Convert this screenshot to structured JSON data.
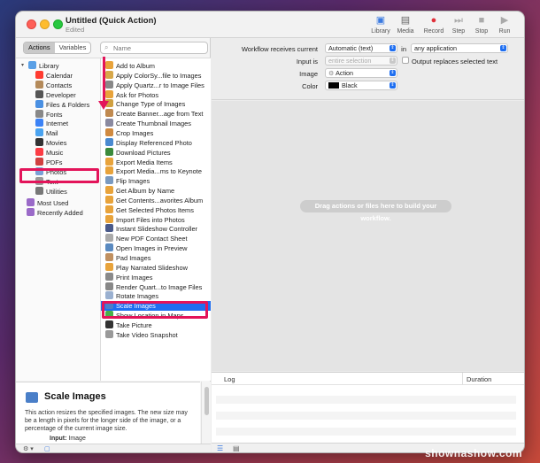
{
  "window": {
    "title": "Untitled (Quick Action)",
    "subtitle": "Edited"
  },
  "toolbar": {
    "library": "Library",
    "media": "Media",
    "record": "Record",
    "step": "Step",
    "stop": "Stop",
    "run": "Run"
  },
  "library_panel": {
    "tab_actions": "Actions",
    "tab_variables": "Variables",
    "search_placeholder": "Name",
    "categories": [
      {
        "label": "Library",
        "color": "#5aa0e6"
      },
      {
        "label": "Calendar",
        "color": "#ff3b30"
      },
      {
        "label": "Contacts",
        "color": "#b48a5a"
      },
      {
        "label": "Developer",
        "color": "#555555"
      },
      {
        "label": "Files & Folders",
        "color": "#4a90e2"
      },
      {
        "label": "Fonts",
        "color": "#888888"
      },
      {
        "label": "Internet",
        "color": "#3b82f6"
      },
      {
        "label": "Mail",
        "color": "#4aa3f0"
      },
      {
        "label": "Movies",
        "color": "#333333"
      },
      {
        "label": "Music",
        "color": "#fc3c44"
      },
      {
        "label": "PDFs",
        "color": "#d04040"
      },
      {
        "label": "Photos",
        "color": "#7aa0d6"
      },
      {
        "label": "Text",
        "color": "#999999"
      },
      {
        "label": "Utilities",
        "color": "#777777"
      },
      {
        "label": "Most Used",
        "color": "#9a6ac8"
      },
      {
        "label": "Recently Added",
        "color": "#9a6ac8"
      }
    ],
    "actions": [
      "Add to Album",
      "Apply ColorSy...file to Images",
      "Apply Quartz...r to Image Files",
      "Ask for Photos",
      "Change Type of Images",
      "Create Banner...age from Text",
      "Create Thumbnail Images",
      "Crop Images",
      "Display Referenced Photo",
      "Download Pictures",
      "Export Media Items",
      "Export Media...ms to Keynote",
      "Flip Images",
      "Get Album by Name",
      "Get Contents...avorites Album",
      "Get Selected Photos Items",
      "Import Files into Photos",
      "Instant Slideshow Controller",
      "New PDF Contact Sheet",
      "Open Images in Preview",
      "Pad Images",
      "Play Narrated Slideshow",
      "Print Images",
      "Render Quart...to Image Files",
      "Rotate Images",
      "Scale Images",
      "Show Location in Maps",
      "Take Picture",
      "Take Video Snapshot"
    ],
    "selected_action": "Scale Images"
  },
  "description": {
    "title": "Scale Images",
    "body": "This action resizes the specified images. The new size may be a length in pixels for the longer side of the image, or a percentage of the current image size.",
    "input_label": "Input:",
    "input_value": "Image"
  },
  "workflow_options": {
    "receives_label": "Workflow receives current",
    "receives_value": "Automatic (text)",
    "in_label": "in",
    "in_value": "any application",
    "input_is_label": "Input is",
    "input_is_value": "entire selection",
    "replaces_label": "Output replaces selected text",
    "image_label": "Image",
    "image_value": "Action",
    "color_label": "Color",
    "color_value": "Black"
  },
  "canvas": {
    "hint": "Drag actions or files here to build your workflow."
  },
  "log": {
    "col_log": "Log",
    "col_duration": "Duration"
  },
  "watermark": "shownashow.com",
  "colors": {
    "accent": "#1e6ef0",
    "highlight": "#e3145a"
  }
}
